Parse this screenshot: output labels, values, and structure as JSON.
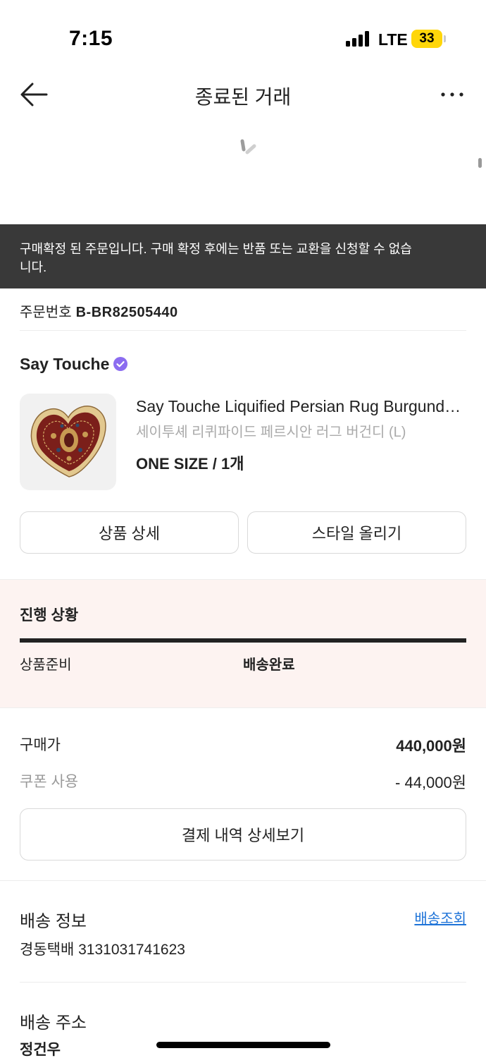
{
  "status_bar": {
    "time": "7:15",
    "network": "LTE",
    "battery": "33",
    "battery_color": "#ffd60a"
  },
  "header": {
    "title": "종료된 거래",
    "back_icon": "arrow-left-icon",
    "more_icon": "more-horizontal-icon"
  },
  "notice": {
    "text": "구매확정 된 주문입니다. 구매 확정 후에는 반품 또는 교환을 신청할 수 없습니다.",
    "background": "#393939"
  },
  "order": {
    "number_label": "주문번호",
    "number": "B-BR82505440"
  },
  "brand": {
    "name": "Say Touche",
    "verified_icon": "verified-badge-icon",
    "verified_color": "#8b6cf0"
  },
  "product": {
    "title": "Say Touche Liquified Persian Rug Burgundy (L)",
    "subtitle": "세이투셰 리퀴파이드 페르시안 러그 버건디 (L)",
    "option": "ONE SIZE / 1개"
  },
  "actions": {
    "product_detail": "상품 상세",
    "upload_style": "스타일 올리기"
  },
  "progress": {
    "title": "진행 상황",
    "steps": [
      {
        "label": "상품준비",
        "done": false
      },
      {
        "label": "배송완료",
        "done": true
      }
    ],
    "completion": 1.0,
    "background": "#fdf3f1"
  },
  "payment": {
    "purchase_price_label": "구매가",
    "purchase_price": "440,000원",
    "coupon_label": "쿠폰 사용",
    "coupon_value": "- 44,000원",
    "detail_button": "결제 내역 상세보기"
  },
  "shipping": {
    "title": "배송 정보",
    "track_link": "배송조회",
    "track_link_color": "#1e73d8",
    "courier": "경동택배 3131031741623"
  },
  "address": {
    "title": "배송 주소",
    "name": "정건우"
  }
}
